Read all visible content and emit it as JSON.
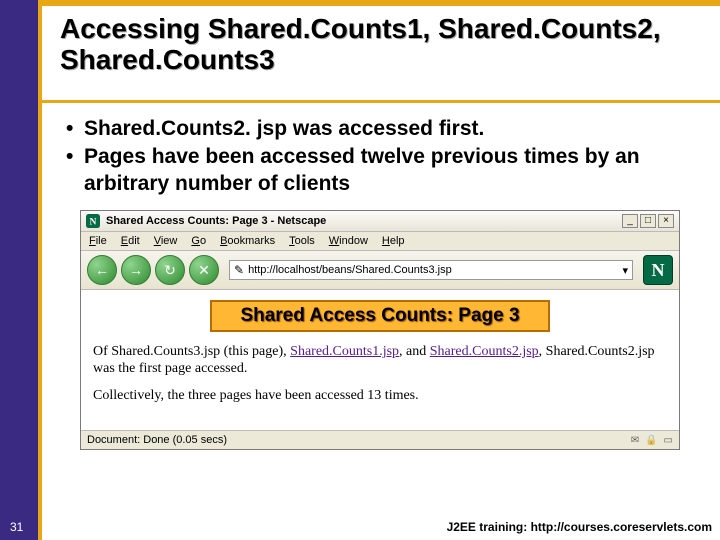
{
  "slide": {
    "title": "Accessing Shared.Counts1, Shared.Counts2, Shared.Counts3",
    "bullets": [
      "Shared.Counts2. jsp was accessed first.",
      "Pages have been accessed twelve previous times by an arbitrary number of clients"
    ],
    "number": "31",
    "footer": "J2EE training: http://courses.coreservlets.com"
  },
  "browser": {
    "window_title": "Shared Access Counts: Page 3 - Netscape",
    "menu": {
      "file": "File",
      "edit": "Edit",
      "view": "View",
      "go": "Go",
      "bookmarks": "Bookmarks",
      "tools": "Tools",
      "window": "Window",
      "help": "Help"
    },
    "nav": {
      "back": "←",
      "forward": "→",
      "reload": "↻",
      "stop": "✕"
    },
    "address": "http://localhost/beans/Shared.Counts3.jsp",
    "logo": "N",
    "page": {
      "heading": "Shared Access Counts: Page 3",
      "p1a": "Of Shared.Counts3.jsp (this page), ",
      "link1": "Shared.Counts1.jsp",
      "mid": ", and ",
      "link2": "Shared.Counts2.jsp",
      "p1b": ", Shared.Counts2.jsp was the first page accessed.",
      "p2": "Collectively, the three pages have been accessed 13 times."
    },
    "status": "Document: Done (0.05 secs)"
  }
}
